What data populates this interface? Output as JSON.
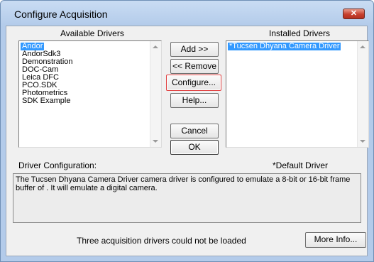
{
  "window": {
    "title": "Configure Acquisition",
    "close_glyph": "✕"
  },
  "available": {
    "header": "Available Drivers",
    "items": [
      "Andor",
      "AndorSdk3",
      "Demonstration",
      "DOC-Cam",
      "Leica DFC",
      "PCO.SDK",
      "Photometrics",
      "SDK Example"
    ],
    "selected_index": 0
  },
  "installed": {
    "header": "Installed Drivers",
    "items": [
      "*Tucsen Dhyana Camera Driver"
    ],
    "selected_index": 0
  },
  "buttons": {
    "add": "Add >>",
    "remove": "<< Remove",
    "configure": "Configure...",
    "help": "Help...",
    "cancel": "Cancel",
    "ok": "OK",
    "more_info": "More Info..."
  },
  "config": {
    "label": "Driver Configuration:",
    "default_note": "*Default Driver",
    "description": "The Tucsen Dhyana Camera Driver camera driver is configured to emulate a 8-bit or 16-bit frame buffer of .  It will emulate a digital camera."
  },
  "status": {
    "message": "Three acquisition drivers could not be loaded"
  },
  "colors": {
    "selection": "#3399ff",
    "title_gradient_top": "#c9dcf3",
    "close_button": "#c7402e",
    "focus_border": "#e04040"
  }
}
